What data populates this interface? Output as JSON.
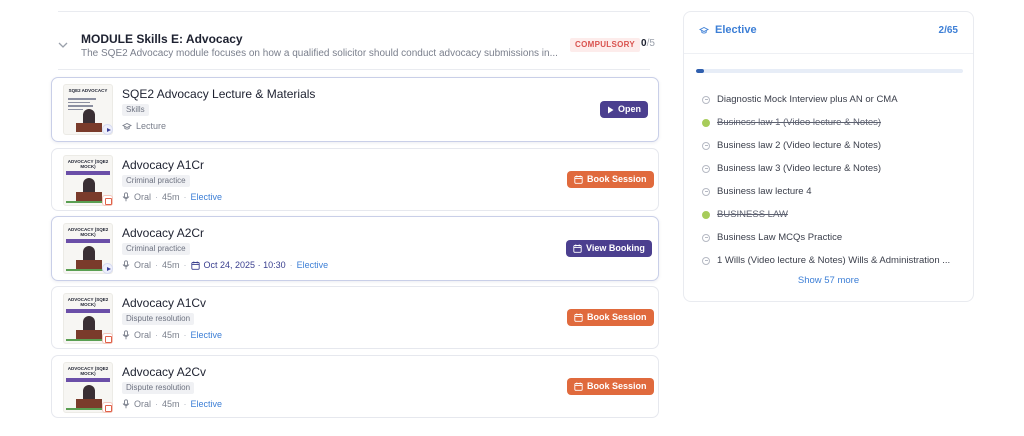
{
  "module": {
    "title": "MODULE Skills E: Advocacy",
    "description": "The SQE2 Advocacy module focuses on how a qualified solicitor should conduct advocacy submissions in...",
    "badge": "COMPULSORY",
    "count_done": "0",
    "count_total": "/5"
  },
  "cards": [
    {
      "title": "SQE2 Advocacy Lecture & Materials",
      "tag": "Skills",
      "type": "Lecture",
      "thumb_title": "SQE2 ADVOCACY",
      "button": "Open"
    },
    {
      "title": "Advocacy A1Cr",
      "tag": "Criminal practice",
      "mode": "Oral",
      "duration": "45m",
      "category": "Elective",
      "thumb_title": "ADVOCACY (SQE2 MOCK)",
      "button": "Book Session"
    },
    {
      "title": "Advocacy A2Cr",
      "tag": "Criminal practice",
      "mode": "Oral",
      "duration": "45m",
      "date": "Oct 24, 2025 · 10:30",
      "category": "Elective",
      "thumb_title": "ADVOCACY (SQE2 MOCK)",
      "button": "View Booking"
    },
    {
      "title": "Advocacy A1Cv",
      "tag": "Dispute resolution",
      "mode": "Oral",
      "duration": "45m",
      "category": "Elective",
      "thumb_title": "ADVOCACY (SQE2 MOCK)",
      "button": "Book Session"
    },
    {
      "title": "Advocacy A2Cv",
      "tag": "Dispute resolution",
      "mode": "Oral",
      "duration": "45m",
      "category": "Elective",
      "thumb_title": "ADVOCACY (SQE2 MOCK)",
      "button": "Book Session"
    }
  ],
  "sidebar": {
    "title": "Elective",
    "ratio": "2/65",
    "progress_fraction": 0.031,
    "items": [
      {
        "label": "Diagnostic Mock Interview plus AN or CMA",
        "done": false
      },
      {
        "label": "Business law 1 (Video lecture & Notes)",
        "done": true
      },
      {
        "label": "Business law 2 (Video lecture & Notes)",
        "done": false
      },
      {
        "label": "Business law 3 (Video lecture & Notes)",
        "done": false
      },
      {
        "label": "Business law lecture 4",
        "done": false
      },
      {
        "label": "BUSINESS LAW",
        "done": true
      },
      {
        "label": "Business Law MCQs Practice",
        "done": false
      },
      {
        "label": "1 Wills (Video lecture & Notes) Wills & Administration ...",
        "done": false
      }
    ],
    "show_more": "Show 57 more"
  },
  "colors": {
    "accent_blue": "#3d7fd6",
    "purple_button": "#4b3f8f",
    "orange_button": "#e06a3d",
    "badge_red": "#d9534f",
    "done_green": "#a7cc5a"
  }
}
